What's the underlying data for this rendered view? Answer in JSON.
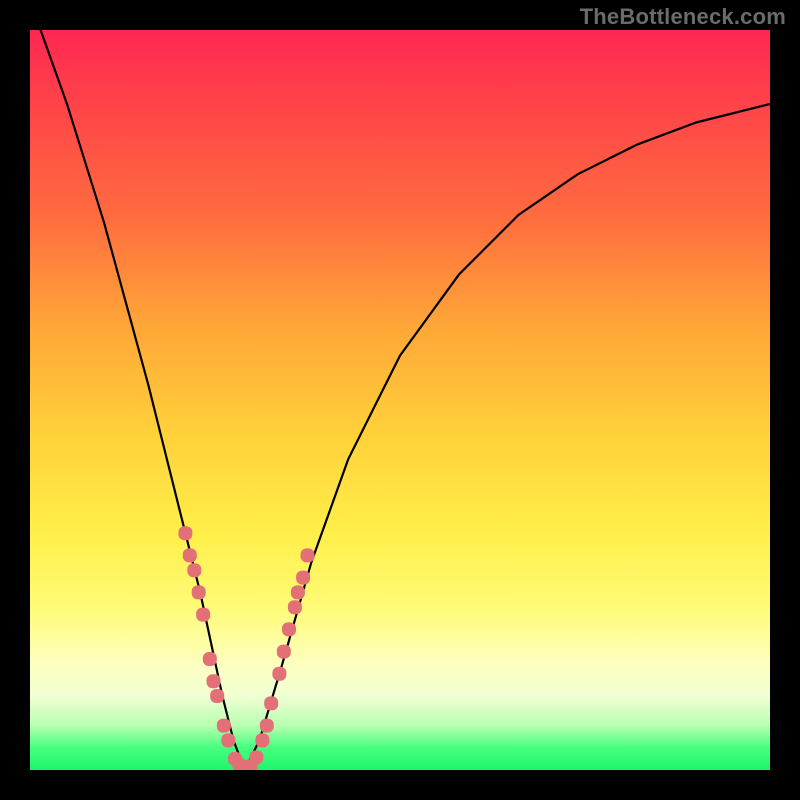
{
  "watermark": "TheBottleneck.com",
  "colors": {
    "curve": "#000000",
    "markers": "#e36f77",
    "frame": "#000000"
  },
  "chart_data": {
    "type": "line",
    "title": "",
    "xlabel": "",
    "ylabel": "",
    "xlim": [
      0,
      100
    ],
    "ylim": [
      0,
      100
    ],
    "grid": false,
    "legend": false,
    "series": [
      {
        "name": "bottleneck-curve",
        "x": [
          0,
          5,
          10,
          13,
          16,
          19,
          21,
          23,
          24.5,
          26,
          27.5,
          29,
          31,
          34,
          38,
          43,
          50,
          58,
          66,
          74,
          82,
          90,
          100
        ],
        "y": [
          104,
          90,
          74,
          63,
          52,
          40,
          32,
          24,
          17,
          10,
          4,
          0,
          4,
          14,
          28,
          42,
          56,
          67,
          75,
          80.5,
          84.5,
          87.5,
          90
        ]
      }
    ],
    "markers": {
      "name": "highlighted-points",
      "points": [
        {
          "x": 21.0,
          "y": 32
        },
        {
          "x": 21.6,
          "y": 29
        },
        {
          "x": 22.2,
          "y": 27
        },
        {
          "x": 22.8,
          "y": 24
        },
        {
          "x": 23.4,
          "y": 21
        },
        {
          "x": 24.3,
          "y": 15
        },
        {
          "x": 24.8,
          "y": 12
        },
        {
          "x": 25.3,
          "y": 10
        },
        {
          "x": 26.2,
          "y": 6
        },
        {
          "x": 26.8,
          "y": 4
        },
        {
          "x": 27.7,
          "y": 1.5
        },
        {
          "x": 28.3,
          "y": 0.7
        },
        {
          "x": 29.0,
          "y": 0.3
        },
        {
          "x": 29.8,
          "y": 0.5
        },
        {
          "x": 30.6,
          "y": 1.7
        },
        {
          "x": 31.4,
          "y": 4
        },
        {
          "x": 32.0,
          "y": 6
        },
        {
          "x": 32.6,
          "y": 9
        },
        {
          "x": 33.7,
          "y": 13
        },
        {
          "x": 34.3,
          "y": 16
        },
        {
          "x": 35.0,
          "y": 19
        },
        {
          "x": 35.8,
          "y": 22
        },
        {
          "x": 36.2,
          "y": 24
        },
        {
          "x": 36.9,
          "y": 26
        },
        {
          "x": 37.5,
          "y": 29
        }
      ]
    }
  }
}
